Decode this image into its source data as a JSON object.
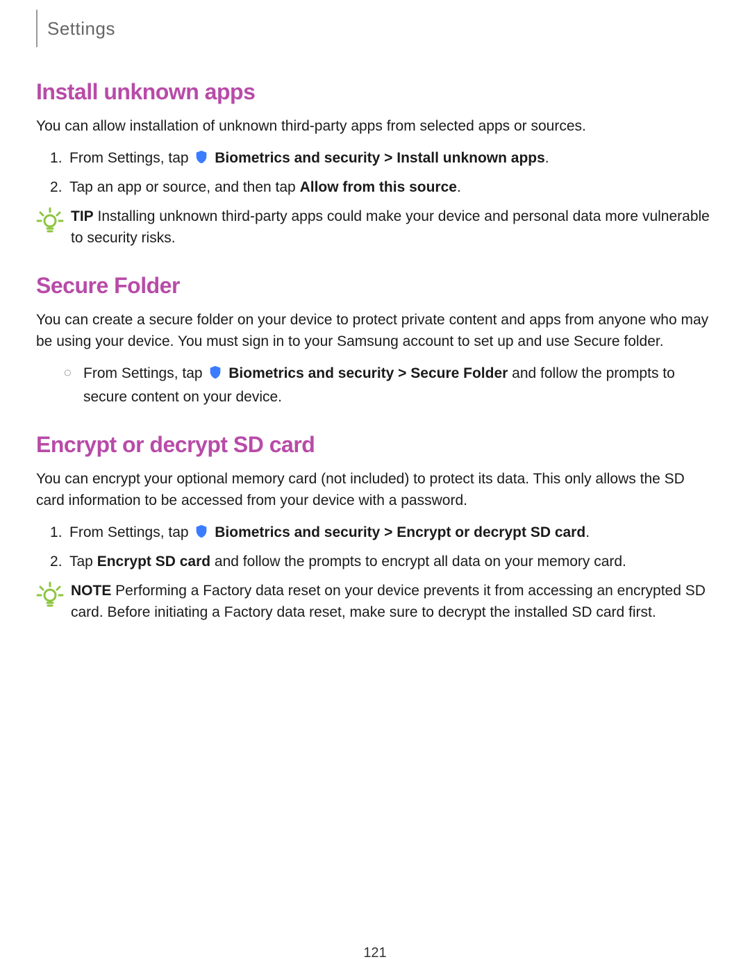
{
  "header": {
    "title": "Settings"
  },
  "page_number": "121",
  "sections": {
    "install_unknown_apps": {
      "heading": "Install unknown apps",
      "intro": "You can allow installation of unknown third-party apps from selected apps or sources.",
      "step1_prefix": "From Settings, tap ",
      "step1_bold": "Biometrics and security > Install unknown apps",
      "step1_suffix": ".",
      "step2_prefix": "Tap an app or source, and then tap ",
      "step2_bold": "Allow from this source",
      "step2_suffix": ".",
      "tip_label": "TIP",
      "tip_body": "  Installing unknown third-party apps could make your device and personal data more vulnerable to security risks."
    },
    "secure_folder": {
      "heading": "Secure Folder",
      "intro": "You can create a secure folder on your device to protect private content and apps from anyone who may be using your device. You must sign in to your Samsung account to set up and use Secure folder.",
      "item_prefix": "From Settings, tap ",
      "item_bold": "Biometrics and security > Secure Folder",
      "item_suffix": " and follow the prompts to secure content on your device."
    },
    "encrypt_sd": {
      "heading": "Encrypt or decrypt SD card",
      "intro": "You can encrypt your optional memory card (not included) to protect its data. This only allows the SD card information to be accessed from your device with a password.",
      "step1_prefix": "From Settings, tap ",
      "step1_bold": "Biometrics and security > Encrypt or decrypt SD card",
      "step1_suffix": ".",
      "step2_prefix": "Tap ",
      "step2_bold": "Encrypt SD card",
      "step2_suffix": " and follow the prompts to encrypt all data on your memory card.",
      "note_label": "NOTE",
      "note_body": "  Performing a Factory data reset on your device prevents it from accessing an encrypted SD card. Before initiating a Factory data reset, make sure to decrypt the installed SD card first."
    }
  }
}
